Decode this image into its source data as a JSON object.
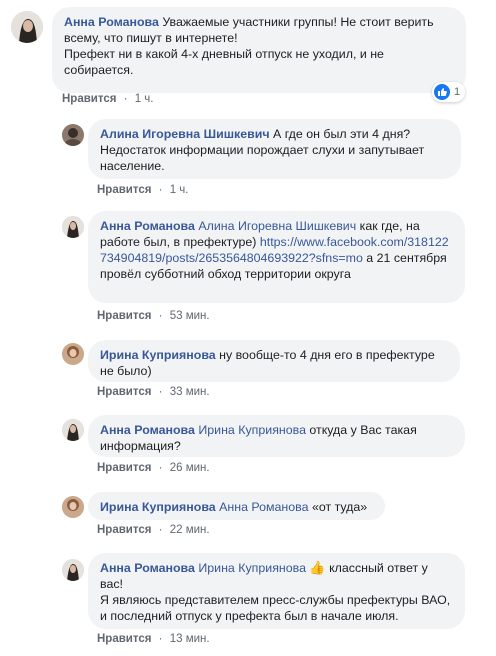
{
  "comments": [
    {
      "author": "Анна Романова",
      "text": "Уважаемые участники группы! Не стоит верить всему, что пишут в интернете!",
      "text2": "Префект ни в какой 4-х дневный отпуск не уходил, и не собирается.",
      "like_label": "Нравится",
      "time": "1 ч.",
      "reaction_count": "1"
    },
    {
      "author": "Алина Игоревна Шишкевич",
      "text": "А где он был эти 4 дня? Недостаток информации порождает слухи и запутывает население.",
      "like_label": "Нравится",
      "time": "1 ч."
    },
    {
      "author": "Анна Романова",
      "mention": "Алина Игоревна Шишкевич",
      "text": "как где, на работе был, в префектуре)",
      "link": "https://www.facebook.com/318122734904819/posts/2653564804693922?sfns=mo",
      "text2": "а 21 сентября провёл субботний обход территории округа",
      "like_label": "Нравится",
      "time": "53 мин."
    },
    {
      "author": "Ирина Куприянова",
      "text": "ну вообще-то 4 дня его в префектуре не было)",
      "like_label": "Нравится",
      "time": "33 мин."
    },
    {
      "author": "Анна Романова",
      "mention": "Ирина Куприянова",
      "text": "откуда у Вас такая информация?",
      "like_label": "Нравится",
      "time": "26 мин."
    },
    {
      "author": "Ирина Куприянова",
      "mention": "Анна Романова",
      "text": "«от туда»",
      "like_label": "Нравится",
      "time": "22 мин."
    },
    {
      "author": "Анна Романова",
      "mention": "Ирина Куприянова",
      "emoji": "👍",
      "text": "классный ответ у вас!",
      "text2": "Я являюсь представителем пресс-службы префектуры ВАО, и последний отпуск у префекта был в начале июля.",
      "like_label": "Нравится",
      "time": "13 мин."
    }
  ],
  "separator": "·"
}
